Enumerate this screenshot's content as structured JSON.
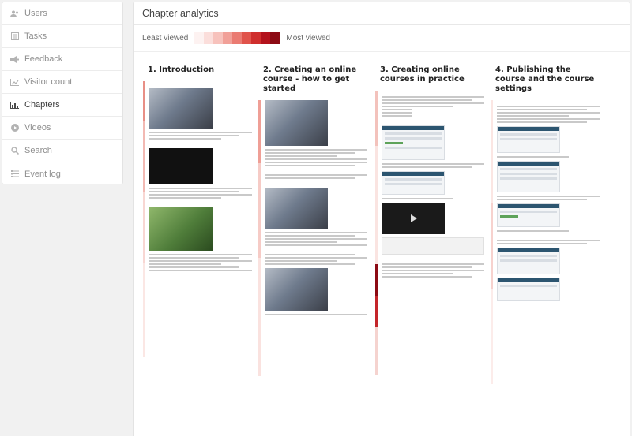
{
  "sidebar": {
    "items": [
      {
        "label": "Users",
        "icon": "users-icon",
        "active": false
      },
      {
        "label": "Tasks",
        "icon": "tasks-icon",
        "active": false
      },
      {
        "label": "Feedback",
        "icon": "megaphone-icon",
        "active": false
      },
      {
        "label": "Visitor count",
        "icon": "line-chart-icon",
        "active": false
      },
      {
        "label": "Chapters",
        "icon": "bar-chart-icon",
        "active": true
      },
      {
        "label": "Videos",
        "icon": "play-icon",
        "active": false
      },
      {
        "label": "Search",
        "icon": "search-icon",
        "active": false
      },
      {
        "label": "Event log",
        "icon": "list-icon",
        "active": false
      }
    ]
  },
  "main": {
    "title": "Chapter analytics",
    "legend": {
      "least": "Least viewed",
      "most": "Most viewed",
      "colors": [
        "#fdf2f1",
        "#fbdedb",
        "#f7c2bc",
        "#f1a098",
        "#ea7b72",
        "#e0534b",
        "#cf2e2d",
        "#b3121c",
        "#8c0a14"
      ]
    },
    "chapters": [
      {
        "title": "1. Introduction"
      },
      {
        "title": "2. Creating an online course - how to get started"
      },
      {
        "title": "3. Creating online courses in practice"
      },
      {
        "title": "4. Publishing the course and the course settings"
      }
    ]
  }
}
